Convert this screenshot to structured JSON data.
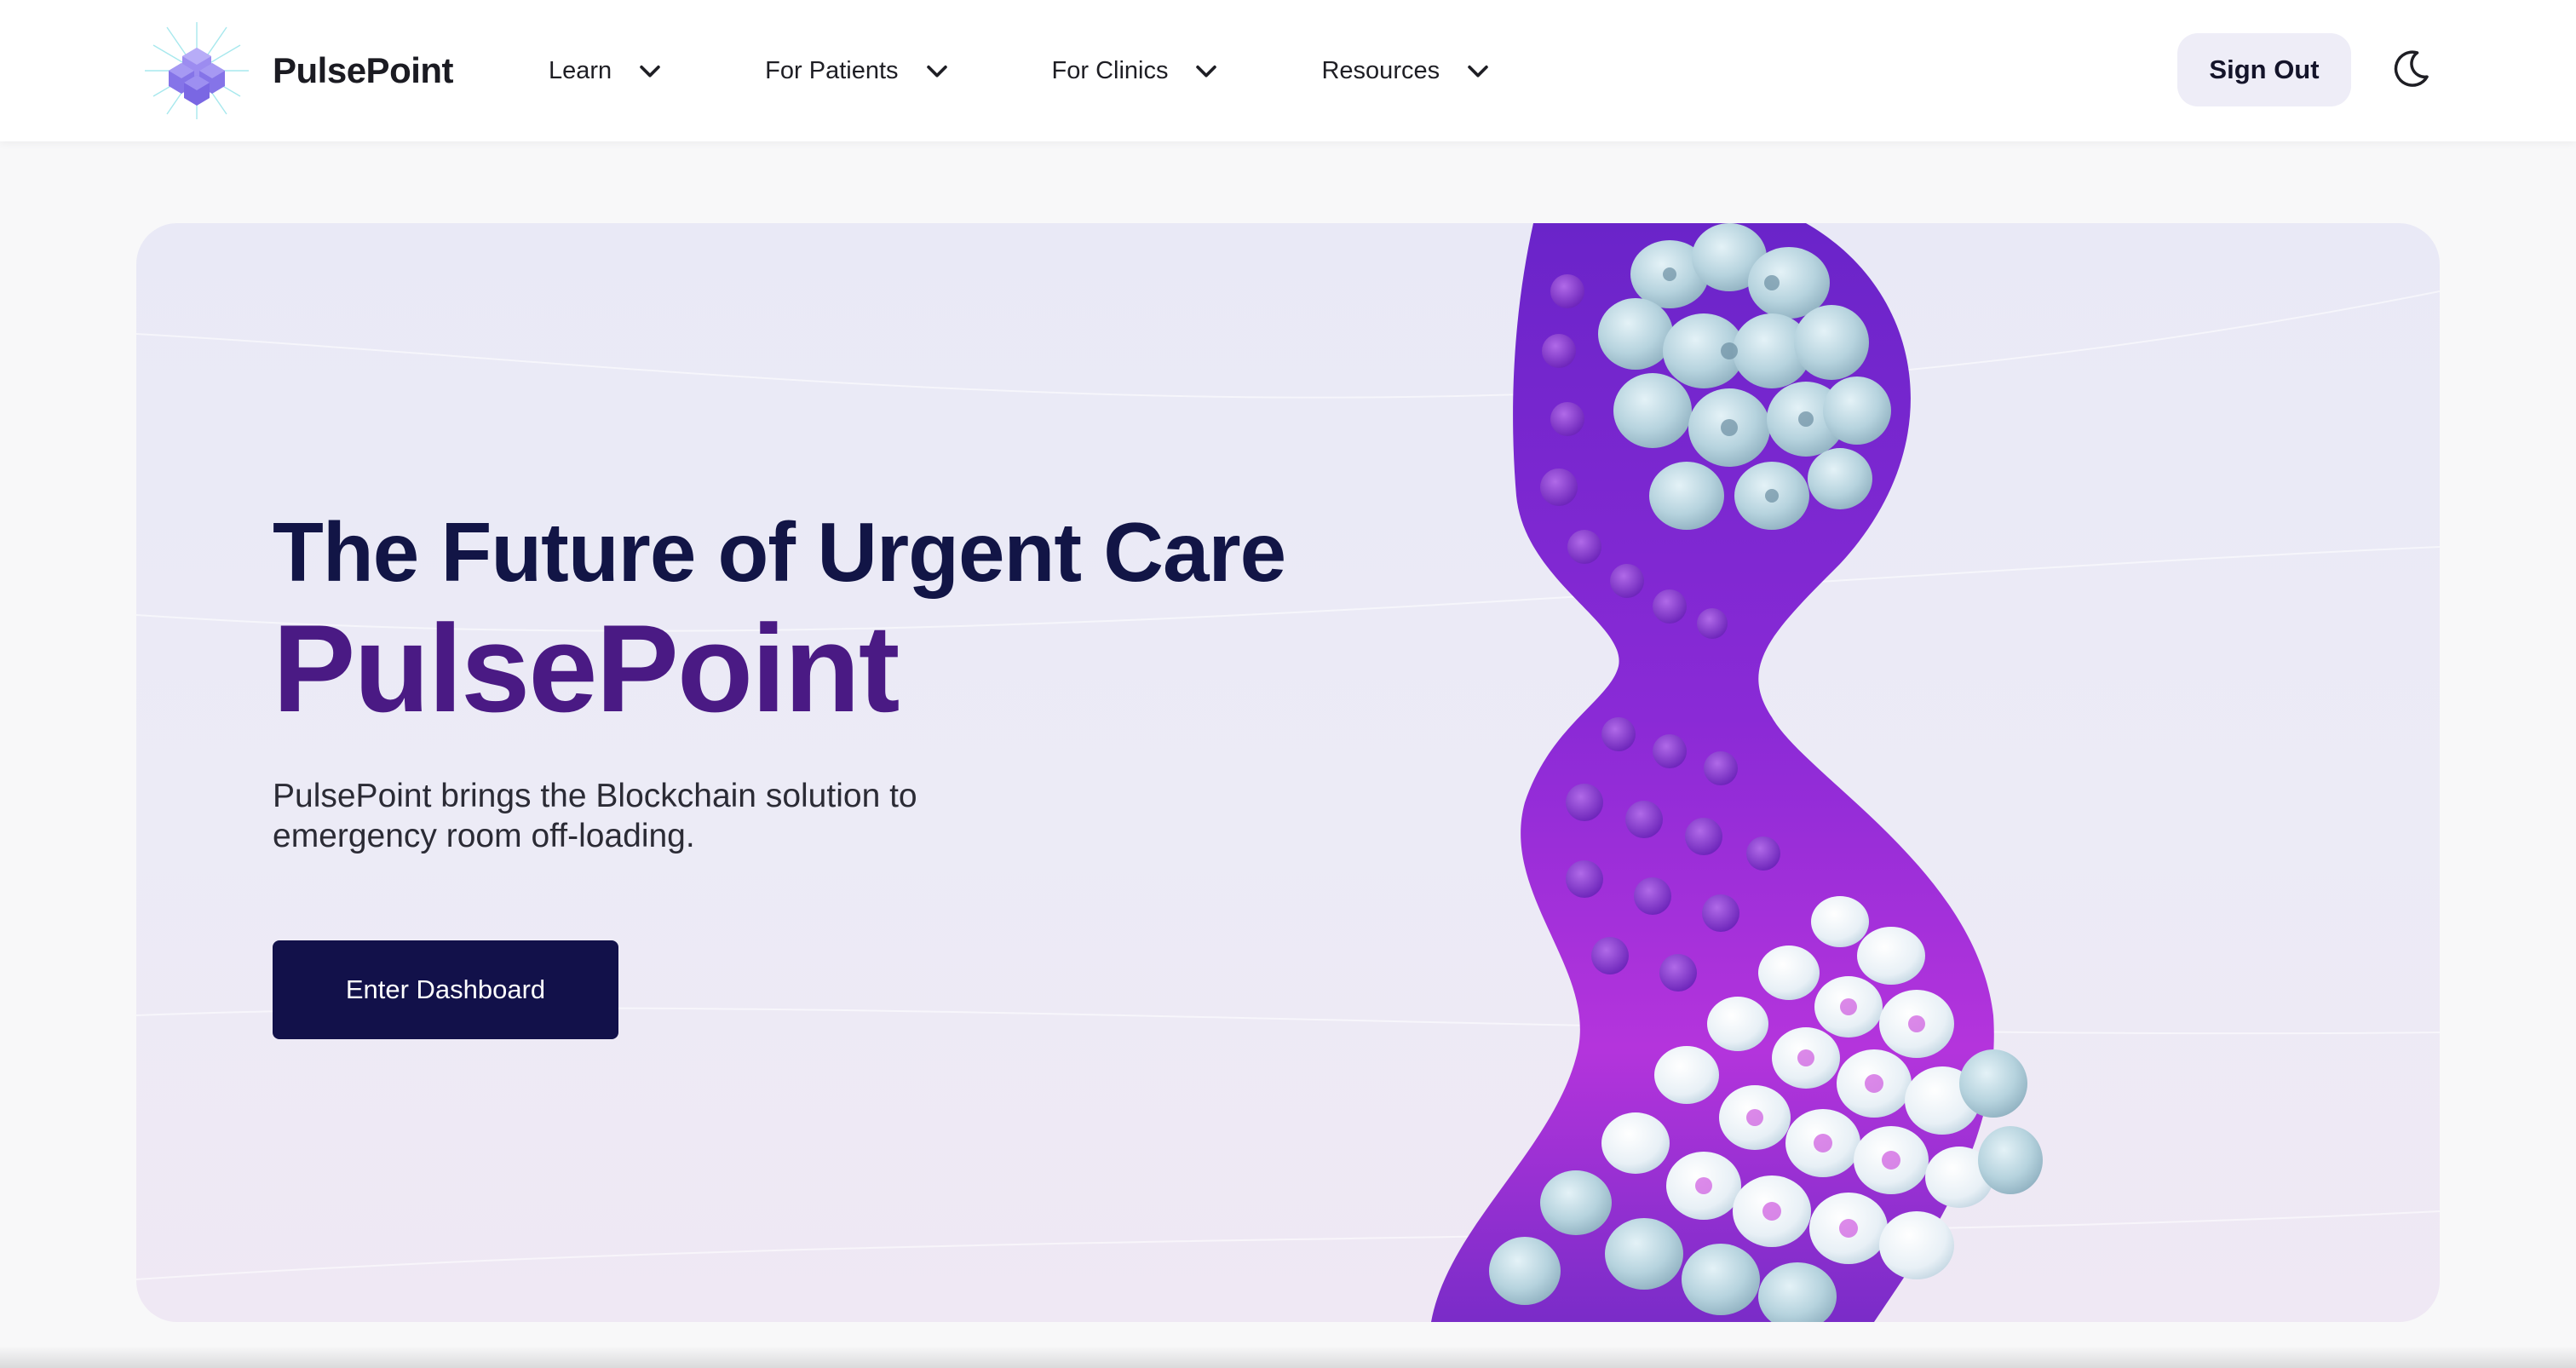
{
  "header": {
    "brand": "PulsePoint",
    "logo_icon": "hexagon-cube-logo",
    "nav": [
      {
        "label": "Learn",
        "icon": "chevron-down-icon"
      },
      {
        "label": "For Patients",
        "icon": "chevron-down-icon"
      },
      {
        "label": "For Clinics",
        "icon": "chevron-down-icon"
      },
      {
        "label": "Resources",
        "icon": "chevron-down-icon"
      }
    ],
    "sign_out_label": "Sign Out",
    "theme_icon": "moon-icon"
  },
  "hero": {
    "title": "The Future of Urgent Care",
    "brand": "PulsePoint",
    "description": "PulsePoint brings the Blockchain solution to emergency room off-loading.",
    "cta_label": "Enter Dashboard",
    "image": "purple-3d-molecular-helix-illustration"
  },
  "colors": {
    "brand_dark": "#121546",
    "brand_purple": "#4a1a84",
    "cta_bg": "#12114a",
    "sign_out_bg": "#eeedf7",
    "hero_bg": "#ebeaf6"
  }
}
